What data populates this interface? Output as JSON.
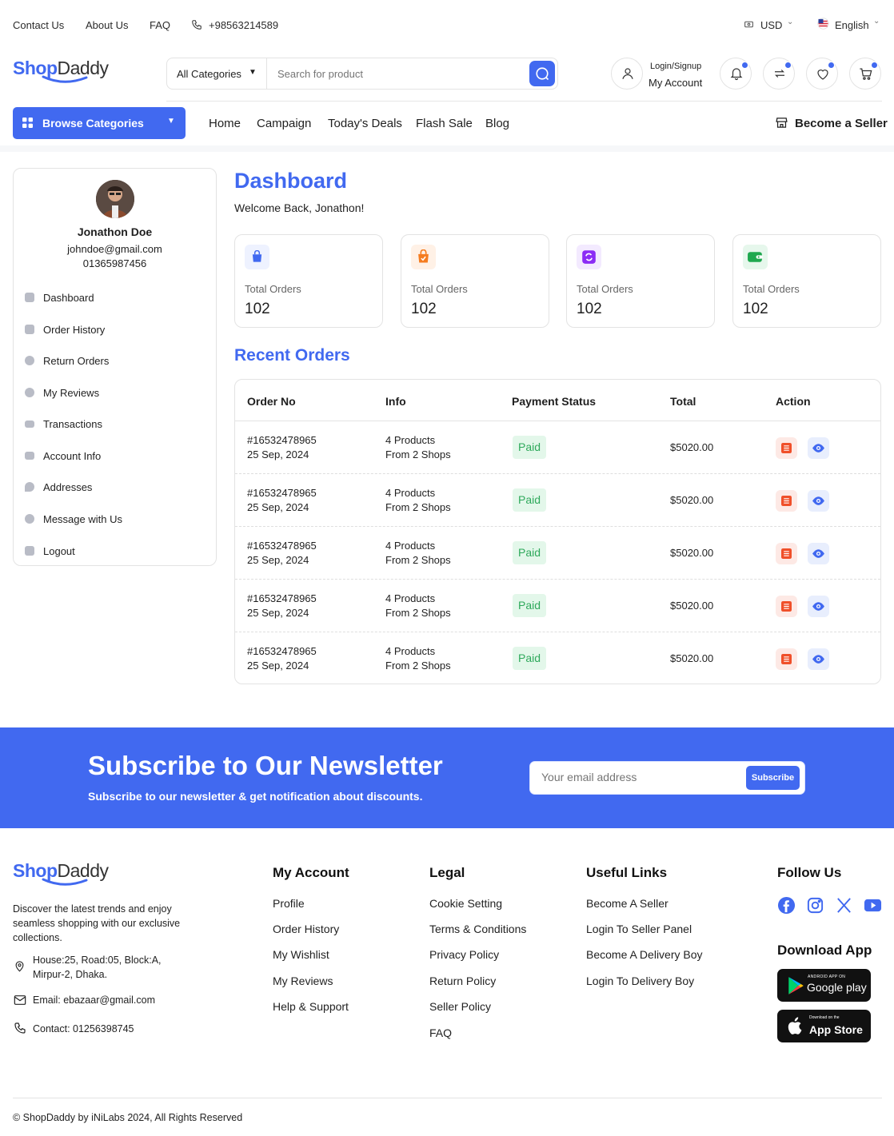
{
  "topbar": {
    "contact": "Contact Us",
    "about": "About Us",
    "faq": "FAQ",
    "phone": "+98563214589",
    "currency": "USD",
    "language": "English"
  },
  "brand": {
    "part1": "Shop",
    "part2": "Daddy",
    "accent": "#4169f0"
  },
  "search": {
    "category": "All Categories",
    "placeholder": "Search for product"
  },
  "account": {
    "line1": "Login/Signup",
    "line2": "My Account"
  },
  "nav": {
    "browse": "Browse Categories",
    "links": [
      "Home",
      "Campaign",
      "Today's Deals",
      "Flash Sale",
      "Blog"
    ],
    "seller": "Become a Seller"
  },
  "profile": {
    "name": "Jonathon Doe",
    "email": "johndoe@gmail.com",
    "phone": "01365987456"
  },
  "sidebar": {
    "items": [
      {
        "label": "Dashboard",
        "icon": "dashboard-icon"
      },
      {
        "label": "Order History",
        "icon": "bag-icon"
      },
      {
        "label": "Return Orders",
        "icon": "return-icon"
      },
      {
        "label": "My Reviews",
        "icon": "star-icon"
      },
      {
        "label": "Transactions",
        "icon": "card-icon"
      },
      {
        "label": "Account Info",
        "icon": "id-card-icon"
      },
      {
        "label": "Addresses",
        "icon": "location-icon"
      },
      {
        "label": "Message with Us",
        "icon": "chat-icon"
      },
      {
        "label": "Logout",
        "icon": "logout-icon"
      }
    ]
  },
  "dashboard": {
    "title": "Dashboard",
    "welcome": "Welcome Back, Jonathon!",
    "cards": [
      {
        "label": "Total Orders",
        "value": "102",
        "color": "#4169f0",
        "bg": "#eef2ff",
        "icon": "bag-icon"
      },
      {
        "label": "Total Orders",
        "value": "102",
        "color": "#f57c1f",
        "bg": "#fff1e6",
        "icon": "bag-check-icon"
      },
      {
        "label": "Total Orders",
        "value": "102",
        "color": "#8b2cf5",
        "bg": "#f3eaff",
        "icon": "refresh-icon"
      },
      {
        "label": "Total Orders",
        "value": "102",
        "color": "#1fa84f",
        "bg": "#e6f7ec",
        "icon": "wallet-icon"
      }
    ]
  },
  "orders": {
    "title": "Recent Orders",
    "headers": [
      "Order No",
      "Info",
      "Payment Status",
      "Total",
      "Action"
    ],
    "rows": [
      {
        "no": "#16532478965",
        "date": "25 Sep, 2024",
        "products": "4 Products",
        "shops": "From 2 Shops",
        "status": "Paid",
        "total": "$5020.00"
      },
      {
        "no": "#16532478965",
        "date": "25 Sep, 2024",
        "products": "4 Products",
        "shops": "From 2 Shops",
        "status": "Paid",
        "total": "$5020.00"
      },
      {
        "no": "#16532478965",
        "date": "25 Sep, 2024",
        "products": "4 Products",
        "shops": "From 2 Shops",
        "status": "Paid",
        "total": "$5020.00"
      },
      {
        "no": "#16532478965",
        "date": "25 Sep, 2024",
        "products": "4 Products",
        "shops": "From 2 Shops",
        "status": "Paid",
        "total": "$5020.00"
      },
      {
        "no": "#16532478965",
        "date": "25 Sep, 2024",
        "products": "4 Products",
        "shops": "From 2 Shops",
        "status": "Paid",
        "total": "$5020.00"
      }
    ]
  },
  "newsletter": {
    "title": "Subscribe to Our Newsletter",
    "subtitle": "Subscribe to our newsletter & get notification about discounts.",
    "placeholder": "Your email address",
    "button": "Subscribe"
  },
  "footer": {
    "description": "Discover the latest trends and enjoy seamless shopping with our exclusive collections.",
    "address1": "House:25, Road:05, Block:A,",
    "address2": "Mirpur-2, Dhaka.",
    "email": "Email: ebazaar@gmail.com",
    "contact": "Contact: 01256398745",
    "my_account": {
      "title": "My Account",
      "links": [
        "Profile",
        "Order History",
        "My Wishlist",
        "My Reviews",
        "Help & Support"
      ]
    },
    "legal": {
      "title": "Legal",
      "links": [
        "Cookie Setting",
        "Terms & Conditions",
        "Privacy Policy",
        "Return Policy",
        "Seller Policy",
        "FAQ"
      ]
    },
    "useful": {
      "title": "Useful Links",
      "links": [
        "Become A Seller",
        "Login To Seller Panel",
        "Become A Delivery Boy",
        "Login To Delivery Boy"
      ]
    },
    "follow": {
      "title": "Follow Us"
    },
    "app": {
      "title": "Download App",
      "google_small": "ANDROID APP ON",
      "google": "Google play",
      "apple_small": "Download on the",
      "apple": "App Store"
    },
    "copyright": "© ShopDaddy by iNiLabs 2024, All Rights Reserved"
  }
}
